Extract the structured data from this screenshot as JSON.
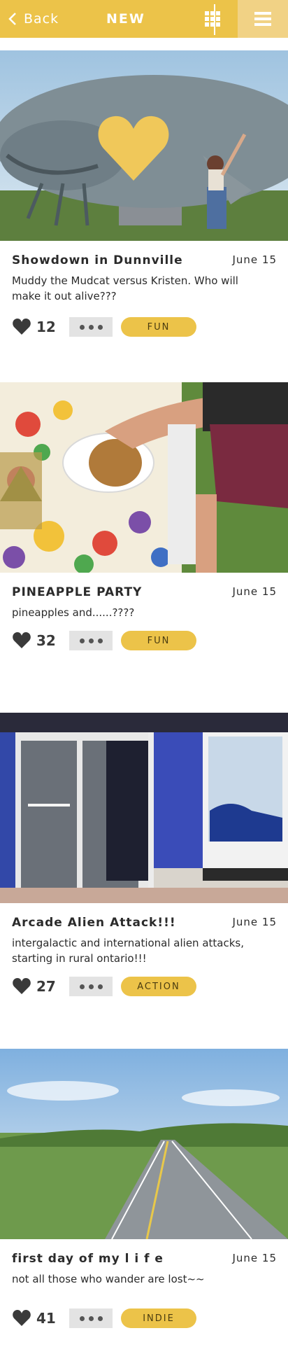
{
  "header": {
    "back_label": "Back",
    "title": "NEW",
    "back_icon": "chevron-left-icon",
    "grid_icon": "grid-icon",
    "menu_icon": "hamburger-menu-icon"
  },
  "colors": {
    "accent": "#ecc349",
    "accent_light": "#f1d285",
    "chip_grey": "#e3e3e3"
  },
  "posts": [
    {
      "title": "Showdown in Dunnville",
      "date": "June 15",
      "description": "Muddy the Mudcat versus Kristen. Who will make it out alive???",
      "likes": "12",
      "tag": "FUN"
    },
    {
      "title": "PINEAPPLE PARTY",
      "date": "June 15",
      "description": "pineapples and......????",
      "likes": "32",
      "tag": "FUN"
    },
    {
      "title": "Arcade Alien Attack!!!",
      "date": "June 15",
      "description": "intergalactic and international alien attacks, starting in rural ontario!!!",
      "likes": "27",
      "tag": "ACTION"
    },
    {
      "title": "first day of my l i f e",
      "date": "June 15",
      "description": "not all those who wander are lost~~",
      "likes": "41",
      "tag": "INDIE"
    }
  ]
}
